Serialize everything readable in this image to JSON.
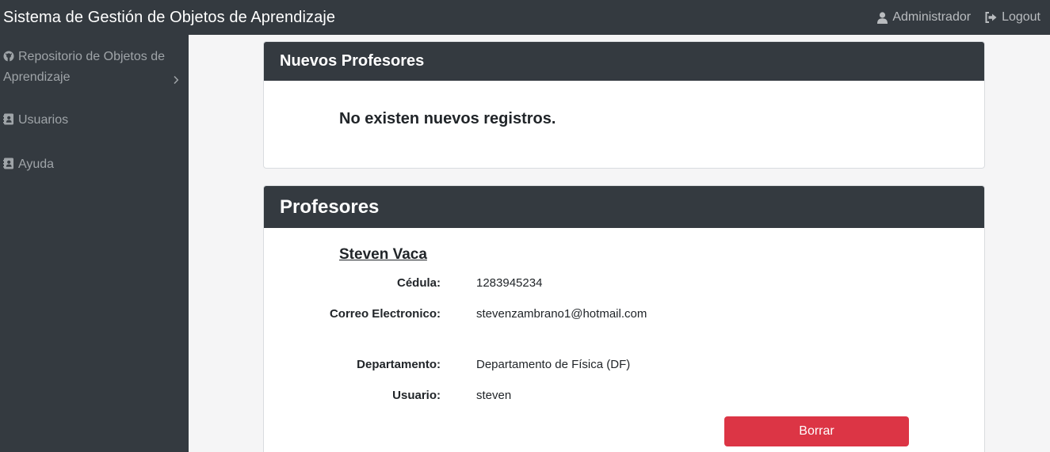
{
  "navbar": {
    "brand": "Sistema de Gestión de Objetos de Aprendizaje",
    "user_label": "Administrador",
    "logout_label": "Logout",
    "user_icon": "user-icon",
    "logout_icon": "sign-out-icon"
  },
  "sidebar": {
    "items": [
      {
        "label": "Repositorio de Objetos de Aprendizaje",
        "icon": "github-icon",
        "has_submenu": true
      },
      {
        "label": "Usuarios",
        "icon": "address-book-icon"
      },
      {
        "label": "Ayuda",
        "icon": "address-book-icon"
      }
    ]
  },
  "new_teachers": {
    "title": "Nuevos Profesores",
    "empty_message": "No existen nuevos registros."
  },
  "teachers": {
    "title": "Profesores",
    "list": [
      {
        "name": "Steven Vaca",
        "fields": [
          {
            "label": "Cédula:",
            "value": "1283945234"
          },
          {
            "label": "Correo Electronico:",
            "value": "stevenzambrano1@hotmail.com"
          },
          {
            "label": "Departamento:",
            "value": "Departamento de Física (DF)"
          },
          {
            "label": "Usuario:",
            "value": "steven"
          }
        ],
        "delete_label": "Borrar"
      }
    ]
  },
  "colors": {
    "navbar_bg": "#343a40",
    "danger": "#dc3545",
    "page_bg": "#f5f5f6"
  }
}
